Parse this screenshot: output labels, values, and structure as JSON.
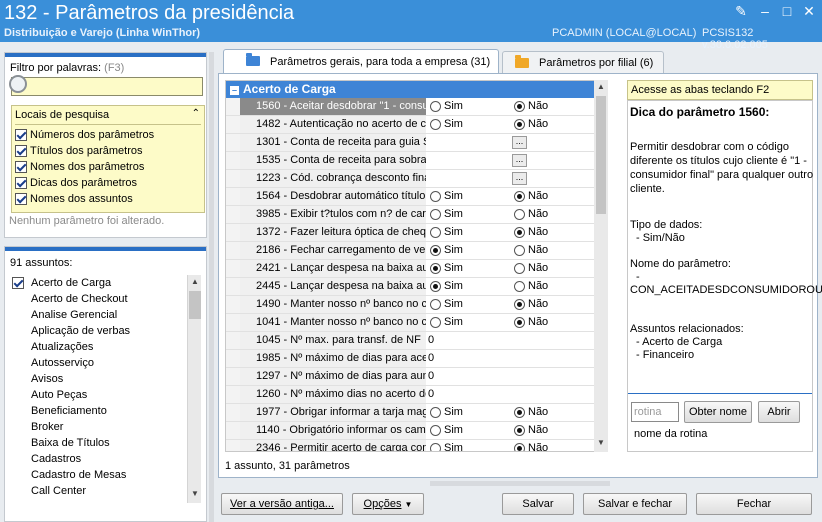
{
  "window": {
    "title": "132 - Parâmetros da presidência",
    "subtitle": "Distribuição e Varejo (Linha WinThor)",
    "user": "PCADMIN (LOCAL@LOCAL)",
    "version": "PCSIS132  v.30.0.02.005",
    "accent_color": "#3a8fd9"
  },
  "filter": {
    "label": "Filtro por palavras:",
    "shortcut": "(F3)",
    "value": "",
    "icon": "magnifier-icon"
  },
  "locais": {
    "title": "Locais de pesquisa",
    "options": [
      {
        "label": "Números dos parâmetros",
        "checked": true
      },
      {
        "label": "Títulos dos parâmetros",
        "checked": true
      },
      {
        "label": "Nomes dos parâmetros",
        "checked": true
      },
      {
        "label": "Dicas dos parâmetros",
        "checked": true
      },
      {
        "label": "Nomes dos assuntos",
        "checked": true
      }
    ],
    "status": "Nenhum parâmetro foi alterado."
  },
  "subjects": {
    "count_label": "91 assuntos:",
    "items": [
      {
        "label": "Acerto de Carga",
        "checked": true
      },
      {
        "label": "Acerto de Checkout"
      },
      {
        "label": "Analise Gerencial"
      },
      {
        "label": "Aplicação de verbas"
      },
      {
        "label": "Atualizações"
      },
      {
        "label": "Autosserviço"
      },
      {
        "label": "Avisos"
      },
      {
        "label": "Auto Peças"
      },
      {
        "label": "Beneficiamento"
      },
      {
        "label": "Broker"
      },
      {
        "label": "Baixa de Títulos"
      },
      {
        "label": "Cadastros"
      },
      {
        "label": "Cadastro de Mesas"
      },
      {
        "label": "Call Center"
      }
    ]
  },
  "tabs": [
    {
      "label": "Parâmetros gerais, para toda a empresa",
      "count": "(31)",
      "active": true
    },
    {
      "label": "Parâmetros por filial",
      "count": "(6)",
      "active": false
    }
  ],
  "grid": {
    "group": "Acerto de Carga",
    "sim_label": "Sim",
    "nao_label": "Não",
    "ellipsis_label": "...",
    "rows": [
      {
        "label": "1560 - Aceitar desdobrar \"1 - consu",
        "kind": "radio",
        "value": "nao",
        "selected": true
      },
      {
        "label": "1482 - Autenticação no acerto de c",
        "kind": "radio",
        "value": "nao"
      },
      {
        "label": "1301 - Conta de receita para guia S",
        "kind": "ellipsis"
      },
      {
        "label": "1535 - Conta de receita para sobra",
        "kind": "ellipsis"
      },
      {
        "label": "1223 - Cód. cobrança desconto fina",
        "kind": "ellipsis"
      },
      {
        "label": "1564 - Desdobrar automático título",
        "kind": "radio",
        "value": "nao"
      },
      {
        "label": "3985 - Exibir t?tulos com n? de carr",
        "kind": "radio",
        "value": "none"
      },
      {
        "label": "1372 - Fazer leitura óptica de cheq",
        "kind": "radio",
        "value": "nao"
      },
      {
        "label": "2186 - Fechar carregamento de ve",
        "kind": "radio",
        "value": "sim"
      },
      {
        "label": "2421 - Lançar despesa na baixa au",
        "kind": "radio",
        "value": "sim"
      },
      {
        "label": "2445 - Lançar despesa na baixa au",
        "kind": "radio",
        "value": "sim"
      },
      {
        "label": "1490 - Manter nosso nº banco no c",
        "kind": "radio",
        "value": "nao"
      },
      {
        "label": "1041 - Manter nosso nº banco no c",
        "kind": "radio",
        "value": "nao"
      },
      {
        "label": "1045 - Nº max. para transf. de NF",
        "kind": "number",
        "text": "0"
      },
      {
        "label": "1985 - Nº máximo de dias para ace",
        "kind": "number",
        "text": "0"
      },
      {
        "label": "1297 - Nº máximo de dias para aun",
        "kind": "number",
        "text": "0"
      },
      {
        "label": "1260 - Nº máximo dias no acerto de",
        "kind": "number",
        "text": "0"
      },
      {
        "label": "1977 - Obrigar informar a tarja mag",
        "kind": "radio",
        "value": "nao"
      },
      {
        "label": "1140 - Obrigatório informar os cam",
        "kind": "radio",
        "value": "nao"
      },
      {
        "label": "2346 - Permitir acerto de carga con",
        "kind": "radio",
        "value": "nao"
      }
    ],
    "status": "1 assunto, 31 parâmetros"
  },
  "hint": {
    "banner": "Acesse as abas teclando F2",
    "title": "Dica do parâmetro 1560:",
    "desc1": "Permitir desdobrar com o código",
    "desc2": "diferente os títulos cujo cliente é \"1 -",
    "desc3": "consumidor final\" para qualquer outro",
    "desc4": "cliente.",
    "tipo_label": "Tipo de dados:",
    "tipo_value": "- Sim/Não",
    "nome_label": "Nome do parâmetro:",
    "nome_dash": "-",
    "nome_value": "CON_ACEITADESDCONSUMIDOROUT",
    "assuntos_label": "Assuntos relacionados:",
    "assunto1": "- Acerto de Carga",
    "assunto2": "- Financeiro",
    "rotina_placeholder": "rotina",
    "obter_nome": "Obter nome",
    "abrir": "Abrir",
    "nome_rotina": "nome da rotina"
  },
  "buttons": {
    "ver_versao": "Ver a versão antiga...",
    "opcoes": "Opções",
    "salvar": "Salvar",
    "salvar_fechar": "Salvar e fechar",
    "fechar": "Fechar"
  }
}
